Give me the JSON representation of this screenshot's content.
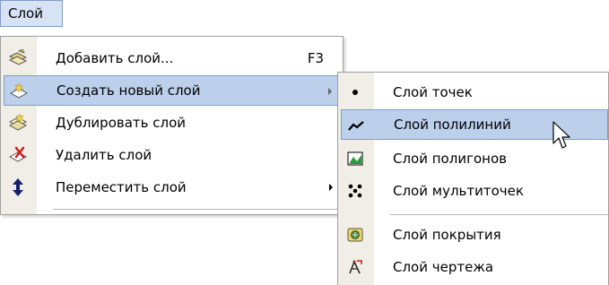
{
  "menubar": {
    "layer_menu": "Слой"
  },
  "main_menu": {
    "items": [
      {
        "label": "Добавить слой...",
        "shortcut": "F3",
        "icon": "add-layer-icon"
      },
      {
        "label": "Создать новый слой",
        "icon": "new-layer-icon",
        "submenu": true,
        "highlighted": true
      },
      {
        "label": "Дублировать слой",
        "icon": "duplicate-layer-icon"
      },
      {
        "label": "Удалить слой",
        "icon": "delete-layer-icon"
      },
      {
        "label": "Переместить слой",
        "icon": "move-layer-icon",
        "submenu": true
      }
    ]
  },
  "submenu": {
    "items": [
      {
        "label": "Слой точек",
        "icon": "point-layer-icon"
      },
      {
        "label": "Слой полилиний",
        "icon": "polyline-layer-icon",
        "highlighted": true
      },
      {
        "label": "Слой полигонов",
        "icon": "polygon-layer-icon"
      },
      {
        "label": "Слой мультиточек",
        "icon": "multipoint-layer-icon"
      },
      {
        "label": "Слой покрытия",
        "icon": "coverage-layer-icon"
      },
      {
        "label": "Слой чертежа",
        "icon": "drawing-layer-icon"
      }
    ]
  },
  "colors": {
    "highlight": "#bcd0ec",
    "highlight_border": "#7e9ccb",
    "gutter": "#f0eee6"
  }
}
